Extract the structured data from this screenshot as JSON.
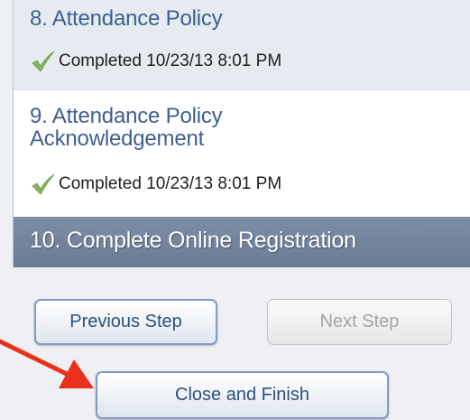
{
  "steps": [
    {
      "title": "8. Attendance Policy",
      "status": "Completed 10/23/13 8:01 PM"
    },
    {
      "title": "9. Attendance Policy Acknowledgement",
      "status": "Completed 10/23/13 8:01 PM"
    },
    {
      "title": "10. Complete Online Registration"
    }
  ],
  "buttons": {
    "previous": "Previous Step",
    "next": "Next Step",
    "finish": "Close and Finish"
  },
  "colors": {
    "annotation_arrow": "#e8301c",
    "active_step": "#6f8099",
    "check": "#84b05b"
  },
  "icons": {
    "status": "checkmark-icon",
    "annotation": "red-arrow-icon"
  }
}
